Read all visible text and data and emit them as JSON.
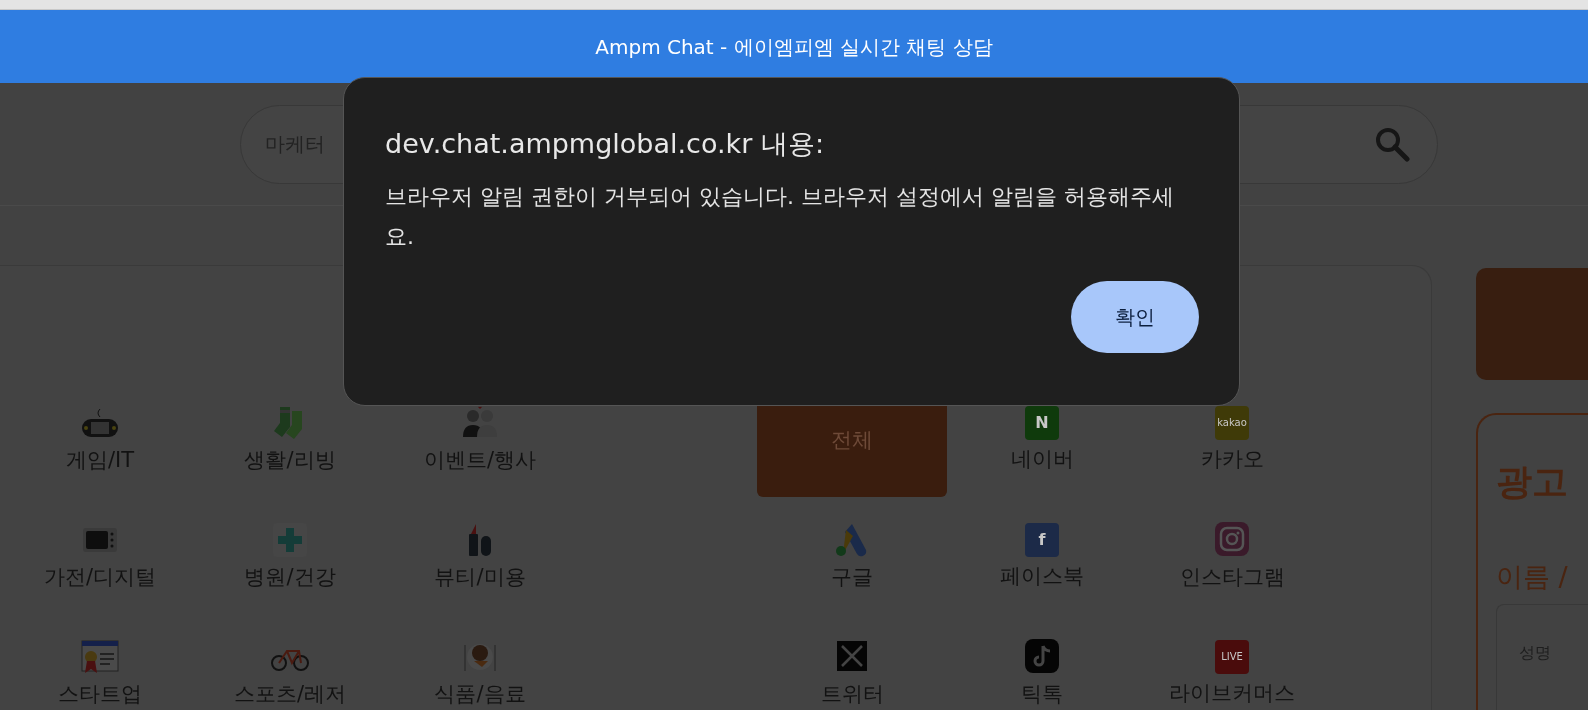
{
  "window": {
    "title": "Ampm Chat - 에이엠피엠 실시간 채팅 상담"
  },
  "search": {
    "placeholder": "마케터"
  },
  "categories": [
    {
      "label": "게임/IT",
      "kind": "gamepad"
    },
    {
      "label": "생활/리빙",
      "kind": "socks"
    },
    {
      "label": "이벤트/행사",
      "kind": "couple"
    },
    {
      "label": "가전/디지털",
      "kind": "tv"
    },
    {
      "label": "병원/건강",
      "kind": "cross"
    },
    {
      "label": "뷰티/미용",
      "kind": "lipstick"
    },
    {
      "label": "스타트업",
      "kind": "certificate"
    },
    {
      "label": "스포츠/레저",
      "kind": "bicycle"
    },
    {
      "label": "식품/음료",
      "kind": "plate"
    }
  ],
  "channels": [
    {
      "label": "전체",
      "kind": "plain",
      "selected": true
    },
    {
      "label": "네이버",
      "kind": "text",
      "logo_text": "N",
      "color": "#0f3a0c",
      "selected": false
    },
    {
      "label": "카카오",
      "kind": "text",
      "logo_text": "kakao",
      "color": "#3f3a08",
      "selected": false
    },
    {
      "label": "구글",
      "kind": "ads",
      "selected": false
    },
    {
      "label": "페이스북",
      "kind": "text",
      "logo_text": "f",
      "color": "#1c2a48",
      "selected": false
    },
    {
      "label": "인스타그램",
      "kind": "camera",
      "selected": false
    },
    {
      "label": "트위터",
      "kind": "x",
      "selected": false
    },
    {
      "label": "틱톡",
      "kind": "note",
      "selected": false
    },
    {
      "label": "라이브커머스",
      "kind": "text",
      "logo_text": "LIVE",
      "color": "#4a0c0c",
      "selected": false
    }
  ],
  "side_panel": {
    "heading": "광고",
    "field_label": "이름 /",
    "field_placeholder": "성명"
  },
  "dialog": {
    "title": "dev.chat.ampmglobal.co.kr 내용:",
    "message": "브라우저 알림 권한이 거부되어 있습니다. 브라우저 설정에서 알림을 허용해주세요.",
    "button": "확인"
  }
}
